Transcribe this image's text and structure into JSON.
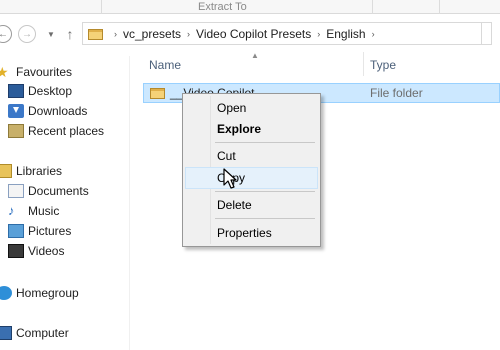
{
  "ribbon": {
    "title": "Extract To"
  },
  "address": {
    "crumbs": [
      "vc_presets",
      "Video Copilot Presets",
      "English"
    ]
  },
  "sidebar": {
    "favourites": {
      "label": "Favourites",
      "items": [
        "Desktop",
        "Downloads",
        "Recent places"
      ]
    },
    "libraries": {
      "label": "Libraries",
      "items": [
        "Documents",
        "Music",
        "Pictures",
        "Videos"
      ]
    },
    "homegroup": "Homegroup",
    "computer": "Computer"
  },
  "columns": {
    "name": "Name",
    "type": "Type"
  },
  "rows": [
    {
      "name": "__Video Copilot_",
      "type": "File folder"
    }
  ],
  "context_menu": {
    "items": [
      "Open",
      "Explore",
      "Cut",
      "Copy",
      "Delete",
      "Properties"
    ]
  },
  "colors": {
    "selection": "#cce8ff",
    "menu_bg": "#f0f0f0",
    "menu_hover": "#e5f1fb",
    "header_text": "#4c607a"
  }
}
